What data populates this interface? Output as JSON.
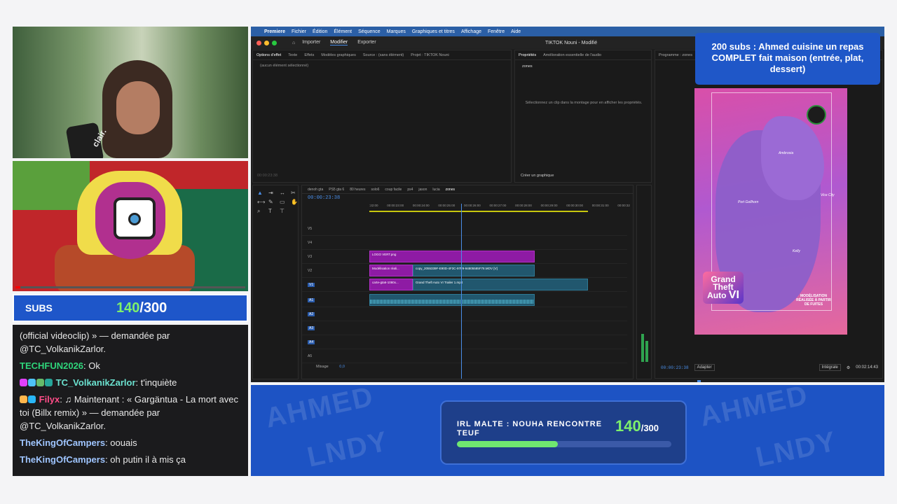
{
  "editor": {
    "menu": [
      "Premiere",
      "Fichier",
      "Édition",
      "Élément",
      "Séquence",
      "Marques",
      "Graphiques et titres",
      "Affichage",
      "Fenêtre",
      "Aide"
    ],
    "nav": [
      "Importer",
      "Modifier",
      "Exporter"
    ],
    "window_title": "TIKTOK Nouni - Modifié",
    "effect_tabs": [
      "Options d'effet",
      "Texte",
      "Effets",
      "Modèles graphiques",
      "Source : (sans élément)",
      "Projet : TIKTOK Nouni"
    ],
    "no_selection": "(aucun élément sélectionné)",
    "effect_timecode": "00:00:23:38",
    "prop_tabs": [
      "Propriétés",
      "Amélioration essentielle de l'audio"
    ],
    "prop_item": "zones",
    "prop_hint": "Sélectionnez un clip dans la montage pour en afficher les propriétés.",
    "create_graphic": "Créer un graphique",
    "program_tab": "Programme : zones",
    "timeline_tabs": [
      "denoh gta",
      "PS5 gta 6",
      "80 heures",
      "solo6",
      "coup facile",
      "ps4",
      "jason",
      "lucia",
      "zones"
    ],
    "timeline_timecode": "00:00:23:38",
    "ruler": [
      ":22:00",
      "00:00:23:00",
      "00:00:24:00",
      "00:00:25:00",
      "00:00:26:00",
      "00:00:27:00",
      "00:00:28:00",
      "00:00:29:00",
      "00:00:30:00",
      "00:00:31:00",
      "00:00:32"
    ],
    "tracks": [
      "V5",
      "V4",
      "V3",
      "V2",
      "V1",
      "A1",
      "A2",
      "A3",
      "A4",
      "A5"
    ],
    "mix_label": "Mixage",
    "mix_value": "0,0",
    "clips": {
      "logo": "LOGO VERT.png",
      "modif": "Modélisation réali...",
      "copy": "copy_2055339F-E90D-4F3C-97F9-94805585F78.MOV [V]",
      "carte": "carte-gta6-1080x...",
      "trailer": "Grand Theft Auto VI Trailer 1.mp4"
    },
    "program_timecode": "00:00:23:38",
    "fit": "Adapter",
    "quality": "Intégrale",
    "duration": "00:02:14:43"
  },
  "tiktok": {
    "logo_line1": "Grand",
    "logo_line2": "Theft",
    "logo_line3": "Auto",
    "logo_num": "VI",
    "credit": "MODÉLISATION RÉALISÉE À PARTIR DE FUITES",
    "cities": [
      "Ambrosia",
      "Port Gellhorn",
      "Vice City",
      "Kelly"
    ]
  },
  "goal_card": "200 subs : Ahmed cuisine un repas COMPLET fait maison (entrée, plat, dessert)",
  "subs": {
    "label": "SUBS",
    "current": "140",
    "separator": "/",
    "goal": "300"
  },
  "chat": [
    {
      "user": "",
      "text": "(official videoclip) » — demandée par @TC_VolkanikZarlor."
    },
    {
      "user": "TECHFUN2026",
      "text": ": Ok"
    },
    {
      "user": "TC_VolkanikZarlor",
      "text": ": t'inquiète"
    },
    {
      "user": "Filyx",
      "text": ": ♫ Maintenant : « Gargäntua - La mort avec toi (Billx remix) » — demandée par @TC_VolkanikZarlor."
    },
    {
      "user": "TheKingOfCampers",
      "text": ": oouais"
    },
    {
      "user": "TheKingOfCampers",
      "text": ": oh putin il à mis ça"
    }
  ],
  "irl": {
    "title": "IRL MALTE : NOUHA RENCONTRE TEUF",
    "current": "140",
    "goal": "/300",
    "progress": 0.47
  },
  "webcam": {
    "mic_text": "clair."
  },
  "colors": {
    "accent": "#1f57c8",
    "green": "#7ef06b",
    "clip_purple": "#8e1ba4",
    "clip_teal": "#21576e"
  }
}
